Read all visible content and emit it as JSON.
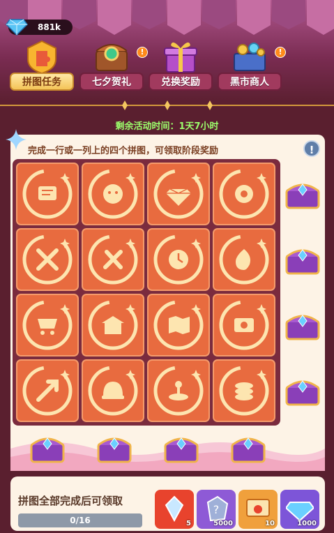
{
  "currency": {
    "amount": "881k",
    "icon": "diamond-icon"
  },
  "tabs": [
    {
      "label": "拼图任务",
      "active": true,
      "badge": ""
    },
    {
      "label": "七夕贺礼",
      "active": false,
      "badge": "!"
    },
    {
      "label": "兑换奖励",
      "active": false,
      "badge": ""
    },
    {
      "label": "黑市商人",
      "active": false,
      "badge": "!"
    }
  ],
  "timer": "剩余活动时间：1天7小时",
  "instruction": "完成一行或一列上的四个拼图，可领取阶段奖励",
  "info_label": "!",
  "puzzle_tiles": [
    "chat-icon",
    "face-icon",
    "diamond-icon",
    "flower-icon",
    "swords-icon",
    "tools-icon",
    "clock-icon",
    "fire-icon",
    "cart-icon",
    "temple-icon",
    "map-icon",
    "ticket-icon",
    "arrow-icon",
    "helmet-icon",
    "joystick-icon",
    "coins-icon"
  ],
  "bottom": {
    "title": "拼图全部完成后可领取",
    "progress": "0/16",
    "progress_value": 0,
    "rewards": [
      {
        "name": "crystal-icon",
        "count": "5",
        "color": "#e8432d"
      },
      {
        "name": "question-stone-icon",
        "count": "5000",
        "color": "#8e5ad6"
      },
      {
        "name": "envelope-icon",
        "count": "10",
        "color": "#f0a03c"
      },
      {
        "name": "diamond-icon",
        "count": "1000",
        "color": "#7d55d8"
      }
    ]
  },
  "colors": {
    "accent": "#e86b3f",
    "timer": "#9cff6c",
    "board": "#7a2b3e"
  }
}
